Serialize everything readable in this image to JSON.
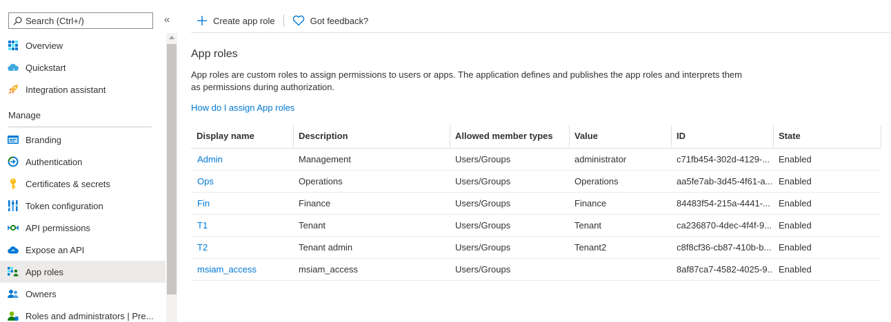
{
  "search": {
    "placeholder": "Search (Ctrl+/)"
  },
  "collapse": {
    "label": "«"
  },
  "nav": {
    "top_items": [
      {
        "label": "Overview",
        "icon": "grid-icon"
      },
      {
        "label": "Quickstart",
        "icon": "cloud-icon"
      },
      {
        "label": "Integration assistant",
        "icon": "rocket-icon"
      }
    ],
    "section_label": "Manage",
    "manage_items": [
      {
        "label": "Branding",
        "icon": "branding-icon"
      },
      {
        "label": "Authentication",
        "icon": "authentication-icon"
      },
      {
        "label": "Certificates & secrets",
        "icon": "key-icon"
      },
      {
        "label": "Token configuration",
        "icon": "token-bars-icon"
      },
      {
        "label": "API permissions",
        "icon": "api-permissions-icon"
      },
      {
        "label": "Expose an API",
        "icon": "cloud-api-icon"
      },
      {
        "label": "App roles",
        "icon": "app-roles-icon",
        "active": true
      },
      {
        "label": "Owners",
        "icon": "owners-icon"
      },
      {
        "label": "Roles and administrators | Pre...",
        "icon": "admin-user-icon"
      }
    ]
  },
  "toolbar": {
    "create_label": "Create app role",
    "feedback_label": "Got feedback?"
  },
  "page": {
    "title": "App roles",
    "description": "App roles are custom roles to assign permissions to users or apps. The application defines and publishes the app roles and interprets them as permissions during authorization.",
    "help_link": "How do I assign App roles"
  },
  "table": {
    "columns": [
      "Display name",
      "Description",
      "Allowed member types",
      "Value",
      "ID",
      "State"
    ],
    "rows": [
      [
        "Admin",
        "Management",
        "Users/Groups",
        "administrator",
        "c71fb454-302d-4129-...",
        "Enabled"
      ],
      [
        "Ops",
        "Operations",
        "Users/Groups",
        "Operations",
        "aa5fe7ab-3d45-4f61-a...",
        "Enabled"
      ],
      [
        "Fin",
        "Finance",
        "Users/Groups",
        "Finance",
        "84483f54-215a-4441-...",
        "Enabled"
      ],
      [
        "T1",
        "Tenant",
        "Users/Groups",
        "Tenant",
        "ca236870-4dec-4f4f-9...",
        "Enabled"
      ],
      [
        "T2",
        "Tenant admin",
        "Users/Groups",
        "Tenant2",
        "c8f8cf36-cb87-410b-b...",
        "Enabled"
      ],
      [
        "msiam_access",
        "msiam_access",
        "Users/Groups",
        "",
        "8af87ca7-4582-4025-9...",
        "Enabled"
      ]
    ]
  },
  "colors": {
    "accent": "#0078d4",
    "active_bg": "#edebe9",
    "text": "#323130"
  }
}
